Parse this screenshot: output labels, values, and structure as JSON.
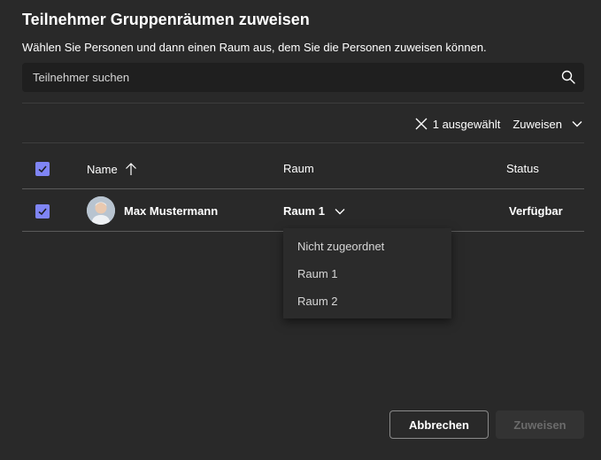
{
  "dialog": {
    "title": "Teilnehmer Gruppenräumen zuweisen",
    "subtitle": "Wählen Sie Personen und dann einen Raum aus, dem Sie die Personen zuweisen können."
  },
  "search": {
    "placeholder": "Teilnehmer suchen",
    "value": "",
    "icon": "search-icon"
  },
  "toolbar": {
    "selected_label": "1 ausgewählt",
    "assign_label": "Zuweisen"
  },
  "table": {
    "headers": {
      "name": "Name",
      "room": "Raum",
      "status": "Status"
    },
    "rows": [
      {
        "name": "Max Mustermann",
        "room": "Raum 1",
        "status": "Verfügbar",
        "selected": true
      }
    ]
  },
  "room_dropdown": {
    "options": [
      "Nicht zugeordnet",
      "Raum 1",
      "Raum 2"
    ]
  },
  "footer": {
    "cancel_label": "Abbrechen",
    "assign_label": "Zuweisen"
  },
  "colors": {
    "background": "#292929",
    "accent": "#7f85f5",
    "input_bg": "#1f1f1f",
    "divider": "#3d3d3d",
    "disabled_text": "#6b6b6b"
  }
}
